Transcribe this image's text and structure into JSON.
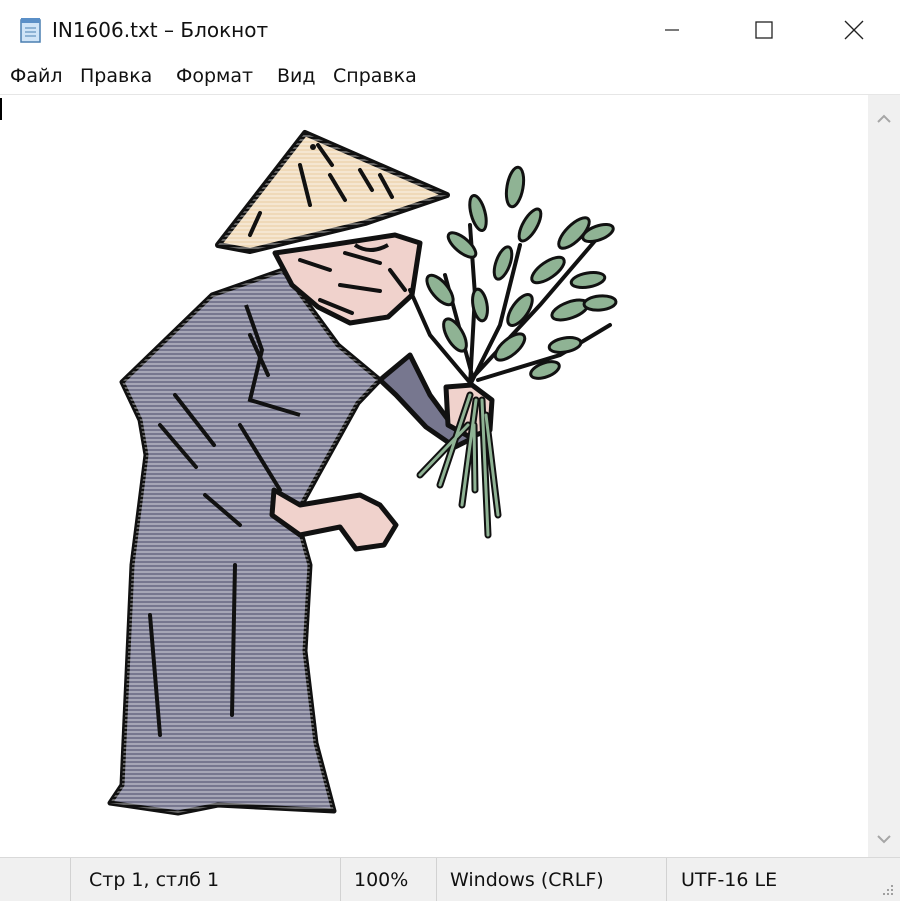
{
  "window": {
    "title": "IN1606.txt – Блокнот"
  },
  "menu": {
    "items": [
      "Файл",
      "Правка",
      "Формат",
      "Вид",
      "Справка"
    ]
  },
  "status": {
    "position": "Стр 1, стлб 1",
    "zoom": "100%",
    "line_ending": "Windows (CRLF)",
    "encoding": "UTF-16 LE"
  },
  "icons": {
    "app": "notepad-icon",
    "minimize": "minimize-icon",
    "maximize": "maximize-icon",
    "close": "close-icon",
    "scroll_up": "chevron-up-icon",
    "scroll_down": "chevron-down-icon",
    "resize": "resize-grip-icon"
  },
  "colors": {
    "hat": "#efd9b9",
    "robe": "#77778f",
    "skin": "#f0d2cc",
    "leaf": "#8fb394",
    "outline": "#111111",
    "chrome": "#f0f0f0"
  }
}
